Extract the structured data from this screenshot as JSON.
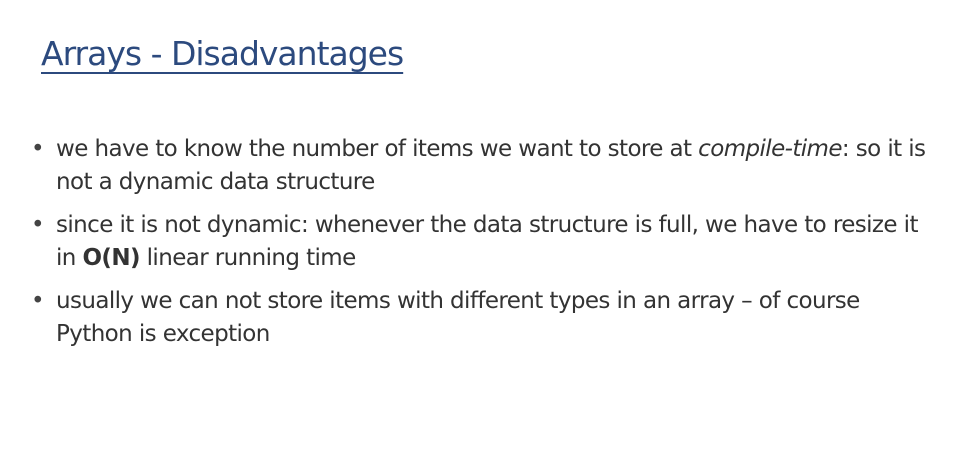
{
  "slide": {
    "title": "Arrays - Disadvantages",
    "bullets": [
      {
        "segments": [
          {
            "text": "we have to know the number of items we want to store at ",
            "style": "normal"
          },
          {
            "text": "compile-time",
            "style": "italic"
          },
          {
            "text": ": so it is not a dynamic data structure",
            "style": "normal"
          }
        ]
      },
      {
        "segments": [
          {
            "text": "since it is not dynamic: whenever the data structure is full, we have to resize it in ",
            "style": "normal"
          },
          {
            "text": "O(N)",
            "style": "bold"
          },
          {
            "text": " linear running time",
            "style": "normal"
          }
        ]
      },
      {
        "segments": [
          {
            "text": "usually we can not store items with different types in an array – of course Python is exception",
            "style": "normal"
          }
        ]
      }
    ],
    "bullet_glyph": "•",
    "colors": {
      "title": "#2c4a7e",
      "text": "#333333",
      "background": "#ffffff"
    }
  }
}
